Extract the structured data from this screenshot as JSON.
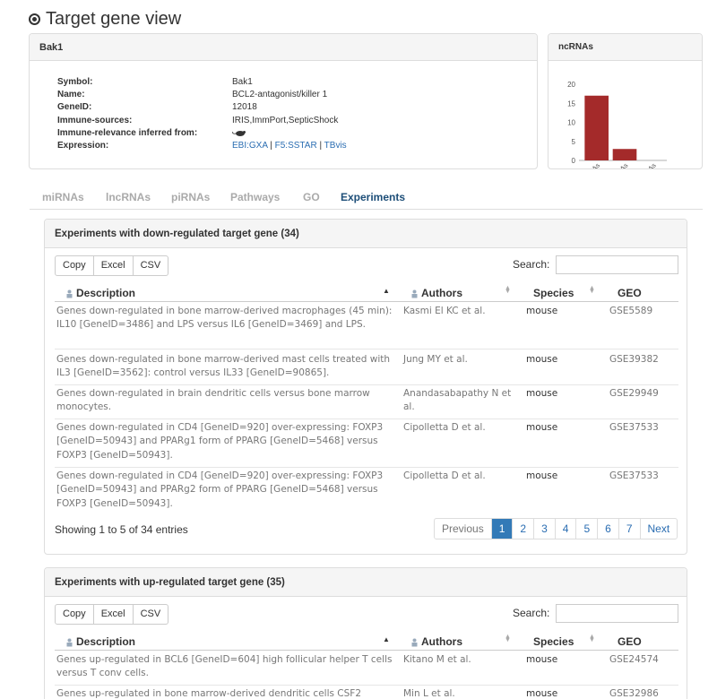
{
  "title": "Target gene view",
  "gene": {
    "name": "Bak1",
    "fields": [
      {
        "label": "Symbol:",
        "value": "Bak1"
      },
      {
        "label": "Name:",
        "value": "BCL2-antagonist/killer 1"
      },
      {
        "label": "GeneID:",
        "value": "12018"
      },
      {
        "label": "Immune-sources:",
        "value": "IRIS,ImmPort,SepticShock"
      },
      {
        "label": "Immune-relevance inferred from:",
        "value": ""
      },
      {
        "label": "Expression:",
        "links": [
          "EBI:GXA",
          "F5:SSTAR",
          "TBvis"
        ]
      }
    ]
  },
  "ncrna": {
    "title": "ncRNAs",
    "chart_data": {
      "type": "bar",
      "categories": [
        "miRNAs",
        "lncRNAs",
        "piRNAs"
      ],
      "values": [
        17,
        3,
        0
      ],
      "ylim": [
        0,
        20
      ],
      "yticks": [
        "0",
        "5",
        "10",
        "15",
        "20"
      ],
      "color": "#a42a2a"
    }
  },
  "tabs": [
    "miRNAs",
    "lncRNAs",
    "piRNAs",
    "Pathways",
    "GO",
    "Experiments"
  ],
  "active_tab": "Experiments",
  "buttons": [
    "Copy",
    "Excel",
    "CSV"
  ],
  "search_label": "Search:",
  "columns": {
    "desc": "Description",
    "auth": "Authors",
    "species": "Species",
    "geo": "GEO"
  },
  "down": {
    "title": "Experiments with down-regulated target gene (34)",
    "rows": [
      {
        "desc": "Genes down-regulated in bone marrow-derived macrophages (45 min): IL10 [GeneID=3486] and LPS versus IL6 [GeneID=3469] and LPS.",
        "auth": "Kasmi El KC et al.",
        "species": "mouse",
        "geo": "GSE5589"
      },
      {
        "desc": "Genes down-regulated in bone marrow-derived mast cells treated with IL3 [GeneID=3562]: control versus IL33 [GeneID=90865].",
        "auth": "Jung MY et al.",
        "species": "mouse",
        "geo": "GSE39382"
      },
      {
        "desc": "Genes down-regulated in brain dendritic cells versus bone marrow monocytes.",
        "auth": "Anandasabapathy N et al.",
        "species": "mouse",
        "geo": "GSE29949"
      },
      {
        "desc": "Genes down-regulated in CD4 [GeneID=920] over-expressing: FOXP3 [GeneID=50943] and PPARg1 form of PPARG [GeneID=5468] versus FOXP3 [GeneID=50943].",
        "auth": "Cipolletta D et al.",
        "species": "mouse",
        "geo": "GSE37533"
      },
      {
        "desc": "Genes down-regulated in CD4 [GeneID=920] over-expressing: FOXP3 [GeneID=50943] and PPARg2 form of PPARG [GeneID=5468] versus FOXP3 [GeneID=50943].",
        "auth": "Cipolletta D et al.",
        "species": "mouse",
        "geo": "GSE37533"
      }
    ],
    "info": "Showing 1 to 5 of 34 entries"
  },
  "up": {
    "title": "Experiments with up-regulated target gene (35)",
    "rows": [
      {
        "desc": "Genes up-regulated in BCL6 [GeneID=604] high follicular helper T cells versus T conv cells.",
        "auth": "Kitano M et al.",
        "species": "mouse",
        "geo": "GSE24574"
      },
      {
        "desc": "Genes up-regulated in bone marrow-derived dendritic cells CSF2",
        "auth": "Min L et al.",
        "species": "mouse",
        "geo": "GSE32986"
      }
    ]
  },
  "pager": {
    "prev": "Previous",
    "pages": [
      "1",
      "2",
      "3",
      "4",
      "5",
      "6",
      "7"
    ],
    "current": "1",
    "next": "Next"
  }
}
